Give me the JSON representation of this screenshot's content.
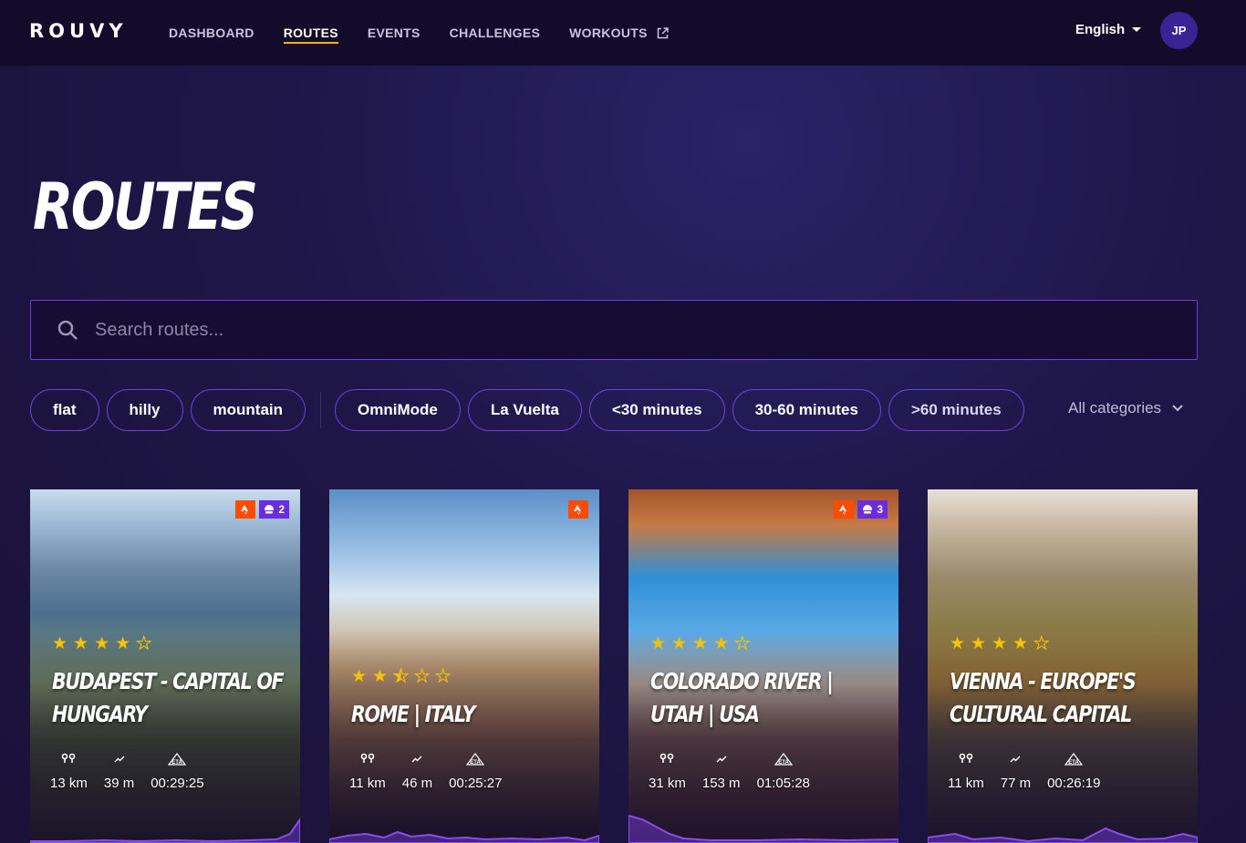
{
  "header": {
    "logo": "ROUVY",
    "nav": [
      {
        "label": "DASHBOARD",
        "active": false
      },
      {
        "label": "ROUTES",
        "active": true
      },
      {
        "label": "EVENTS",
        "active": false
      },
      {
        "label": "CHALLENGES",
        "active": false
      },
      {
        "label": "WORKOUTS",
        "active": false,
        "external_icon": "external-link-icon"
      }
    ],
    "language": "English",
    "avatar_initials": "JP"
  },
  "page": {
    "title": "ROUTES"
  },
  "search": {
    "placeholder": "Search routes...",
    "value": ""
  },
  "filters": {
    "tags": [
      "flat",
      "hilly",
      "mountain"
    ],
    "chips": [
      "OmniMode",
      "La Vuelta",
      "<30 minutes",
      "30-60 minutes",
      ">60 minutes"
    ],
    "category_select": "All categories"
  },
  "colors": {
    "accent": "#f5b400",
    "chip_border": "#6a41d9",
    "strava": "#fc4c02",
    "group_badge": "#6b2ce0",
    "star": "#f5c400"
  },
  "cards": [
    {
      "title": "Budapest - Capital of Hungary",
      "rating": 4,
      "strava": true,
      "group_count": "2",
      "distance": "13 km",
      "elevation": "39 m",
      "eta": "00:29:25"
    },
    {
      "title": "Rome | Italy",
      "rating": 2.5,
      "strava": true,
      "group_count": "",
      "distance": "11 km",
      "elevation": "46 m",
      "eta": "00:25:27"
    },
    {
      "title": "Colorado River | Utah | USA",
      "rating": 4,
      "strava": true,
      "group_count": "3",
      "distance": "31 km",
      "elevation": "153 m",
      "eta": "01:05:28"
    },
    {
      "title": "Vienna - Europe's Cultural Capital",
      "rating": 4,
      "strava": false,
      "group_count": "",
      "distance": "11 km",
      "elevation": "77 m",
      "eta": "00:26:19"
    }
  ]
}
